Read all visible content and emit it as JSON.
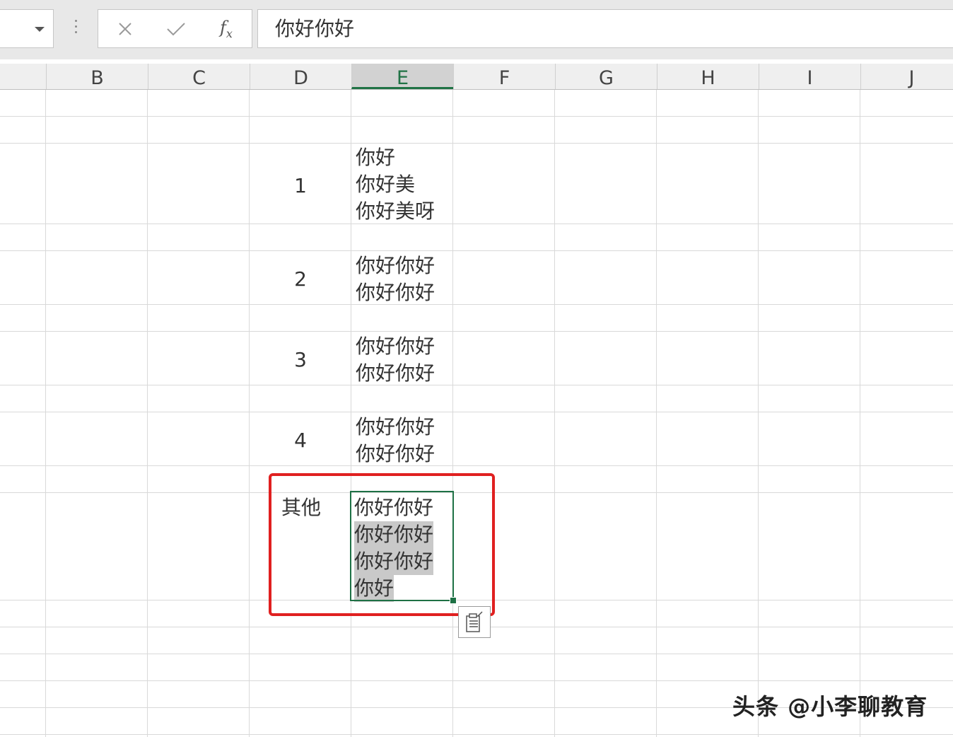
{
  "formula_bar": {
    "cancel_icon": "close-icon",
    "enter_icon": "check-icon",
    "function_label": "fx",
    "formula_value": "你好你好"
  },
  "columns": [
    "B",
    "C",
    "D",
    "E",
    "F",
    "G",
    "H",
    "I",
    "J"
  ],
  "selected_column": "E",
  "cells": {
    "d_row1": "1",
    "e_row1": [
      "你好",
      "你好美",
      "你好美呀"
    ],
    "d_row2": "2",
    "e_row2": [
      "你好你好",
      "你好你好"
    ],
    "d_row3": "3",
    "e_row3": [
      "你好你好",
      "你好你好"
    ],
    "d_row4": "4",
    "e_row4": [
      "你好你好",
      "你好你好"
    ],
    "d_row5": "其他",
    "e_row5": [
      "你好你好",
      "你好你好",
      "你好你好",
      "你好"
    ]
  },
  "annotation_color": "#e02020",
  "selection_color": "#1e7145",
  "watermark": "头条 @小李聊教育"
}
